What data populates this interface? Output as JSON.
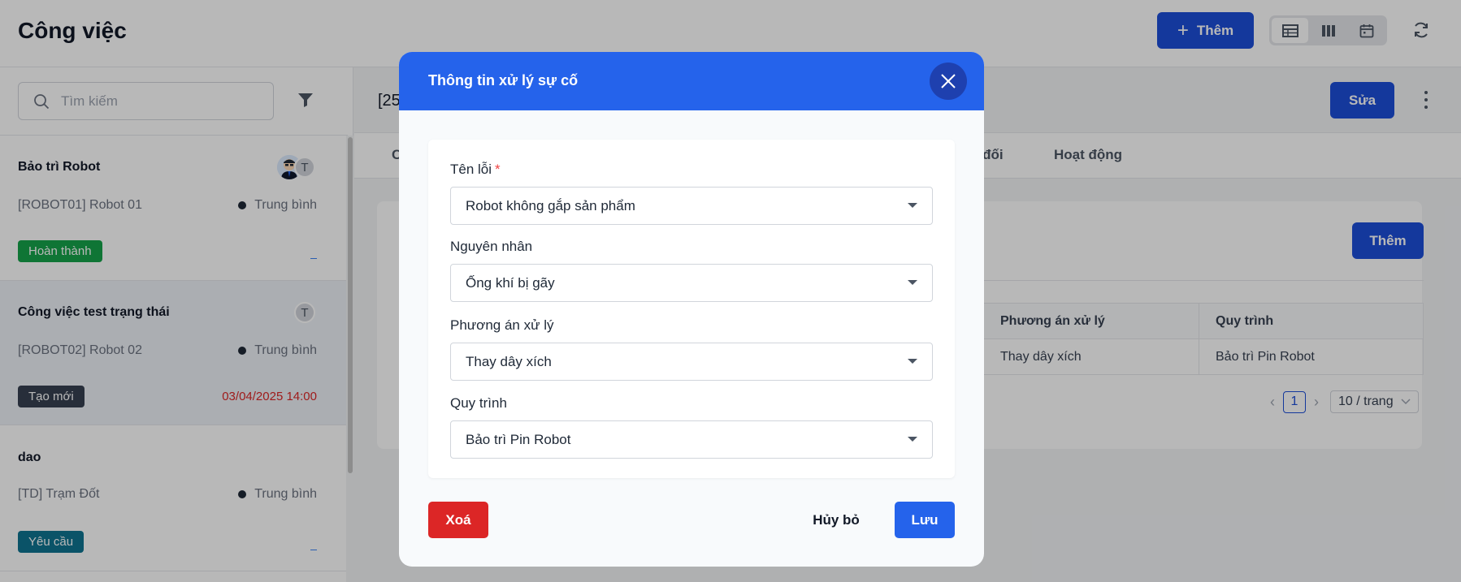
{
  "header": {
    "title": "Công việc",
    "add_label": "Thêm",
    "views": [
      "table-icon",
      "columns-icon",
      "calendar-icon"
    ],
    "refresh_icon": "refresh-icon"
  },
  "sidebar": {
    "search_placeholder": "Tìm kiếm",
    "tasks": [
      {
        "title": "Bảo trì Robot",
        "subtitle": "[ROBOT01] Robot 01",
        "priority": "Trung bình",
        "status": "Hoàn thành",
        "status_color": "#16a34a",
        "avatars": [
          "robot-user-avatar",
          "T"
        ]
      },
      {
        "title": "Công việc test trạng thái",
        "subtitle": "[ROBOT02] Robot 02",
        "priority": "Trung bình",
        "status": "Tạo mới",
        "status_color": "#374151",
        "due": "03/04/2025 14:00",
        "avatars": [
          "T"
        ]
      },
      {
        "title": "dao",
        "subtitle": "[TD] Trạm Đốt",
        "priority": "Trung bình",
        "status": "Yêu cầu",
        "status_color": "#0e7490"
      }
    ]
  },
  "detail": {
    "code_prefix": "[25",
    "edit_label": "Sửa",
    "tabs": [
      "C",
      "o đối",
      "Hoạt động"
    ],
    "card_add_label": "Thêm",
    "table": {
      "headers": [
        "Phương án xử lý",
        "Quy trình"
      ],
      "rows": [
        [
          "Thay dây xích",
          "Bảo trì Pin Robot"
        ]
      ]
    },
    "pagination": {
      "current": "1",
      "page_size": "10 / trang"
    }
  },
  "modal": {
    "title": "Thông tin xử lý sự cố",
    "fields": [
      {
        "label": "Tên lỗi",
        "required": "*",
        "value": "Robot không gắp sản phẩm"
      },
      {
        "label": "Nguyên nhân",
        "value": "Ống khí bị gãy"
      },
      {
        "label": "Phương án xử lý",
        "value": "Thay dây xích"
      },
      {
        "label": "Quy trình",
        "value": "Bảo trì Pin Robot"
      }
    ],
    "delete_label": "Xoá",
    "cancel_label": "Hủy bỏ",
    "save_label": "Lưu"
  },
  "colors": {
    "primary": "#2563eb",
    "danger": "#dc2626",
    "overlay": "rgba(0,0,0,0.28)"
  }
}
